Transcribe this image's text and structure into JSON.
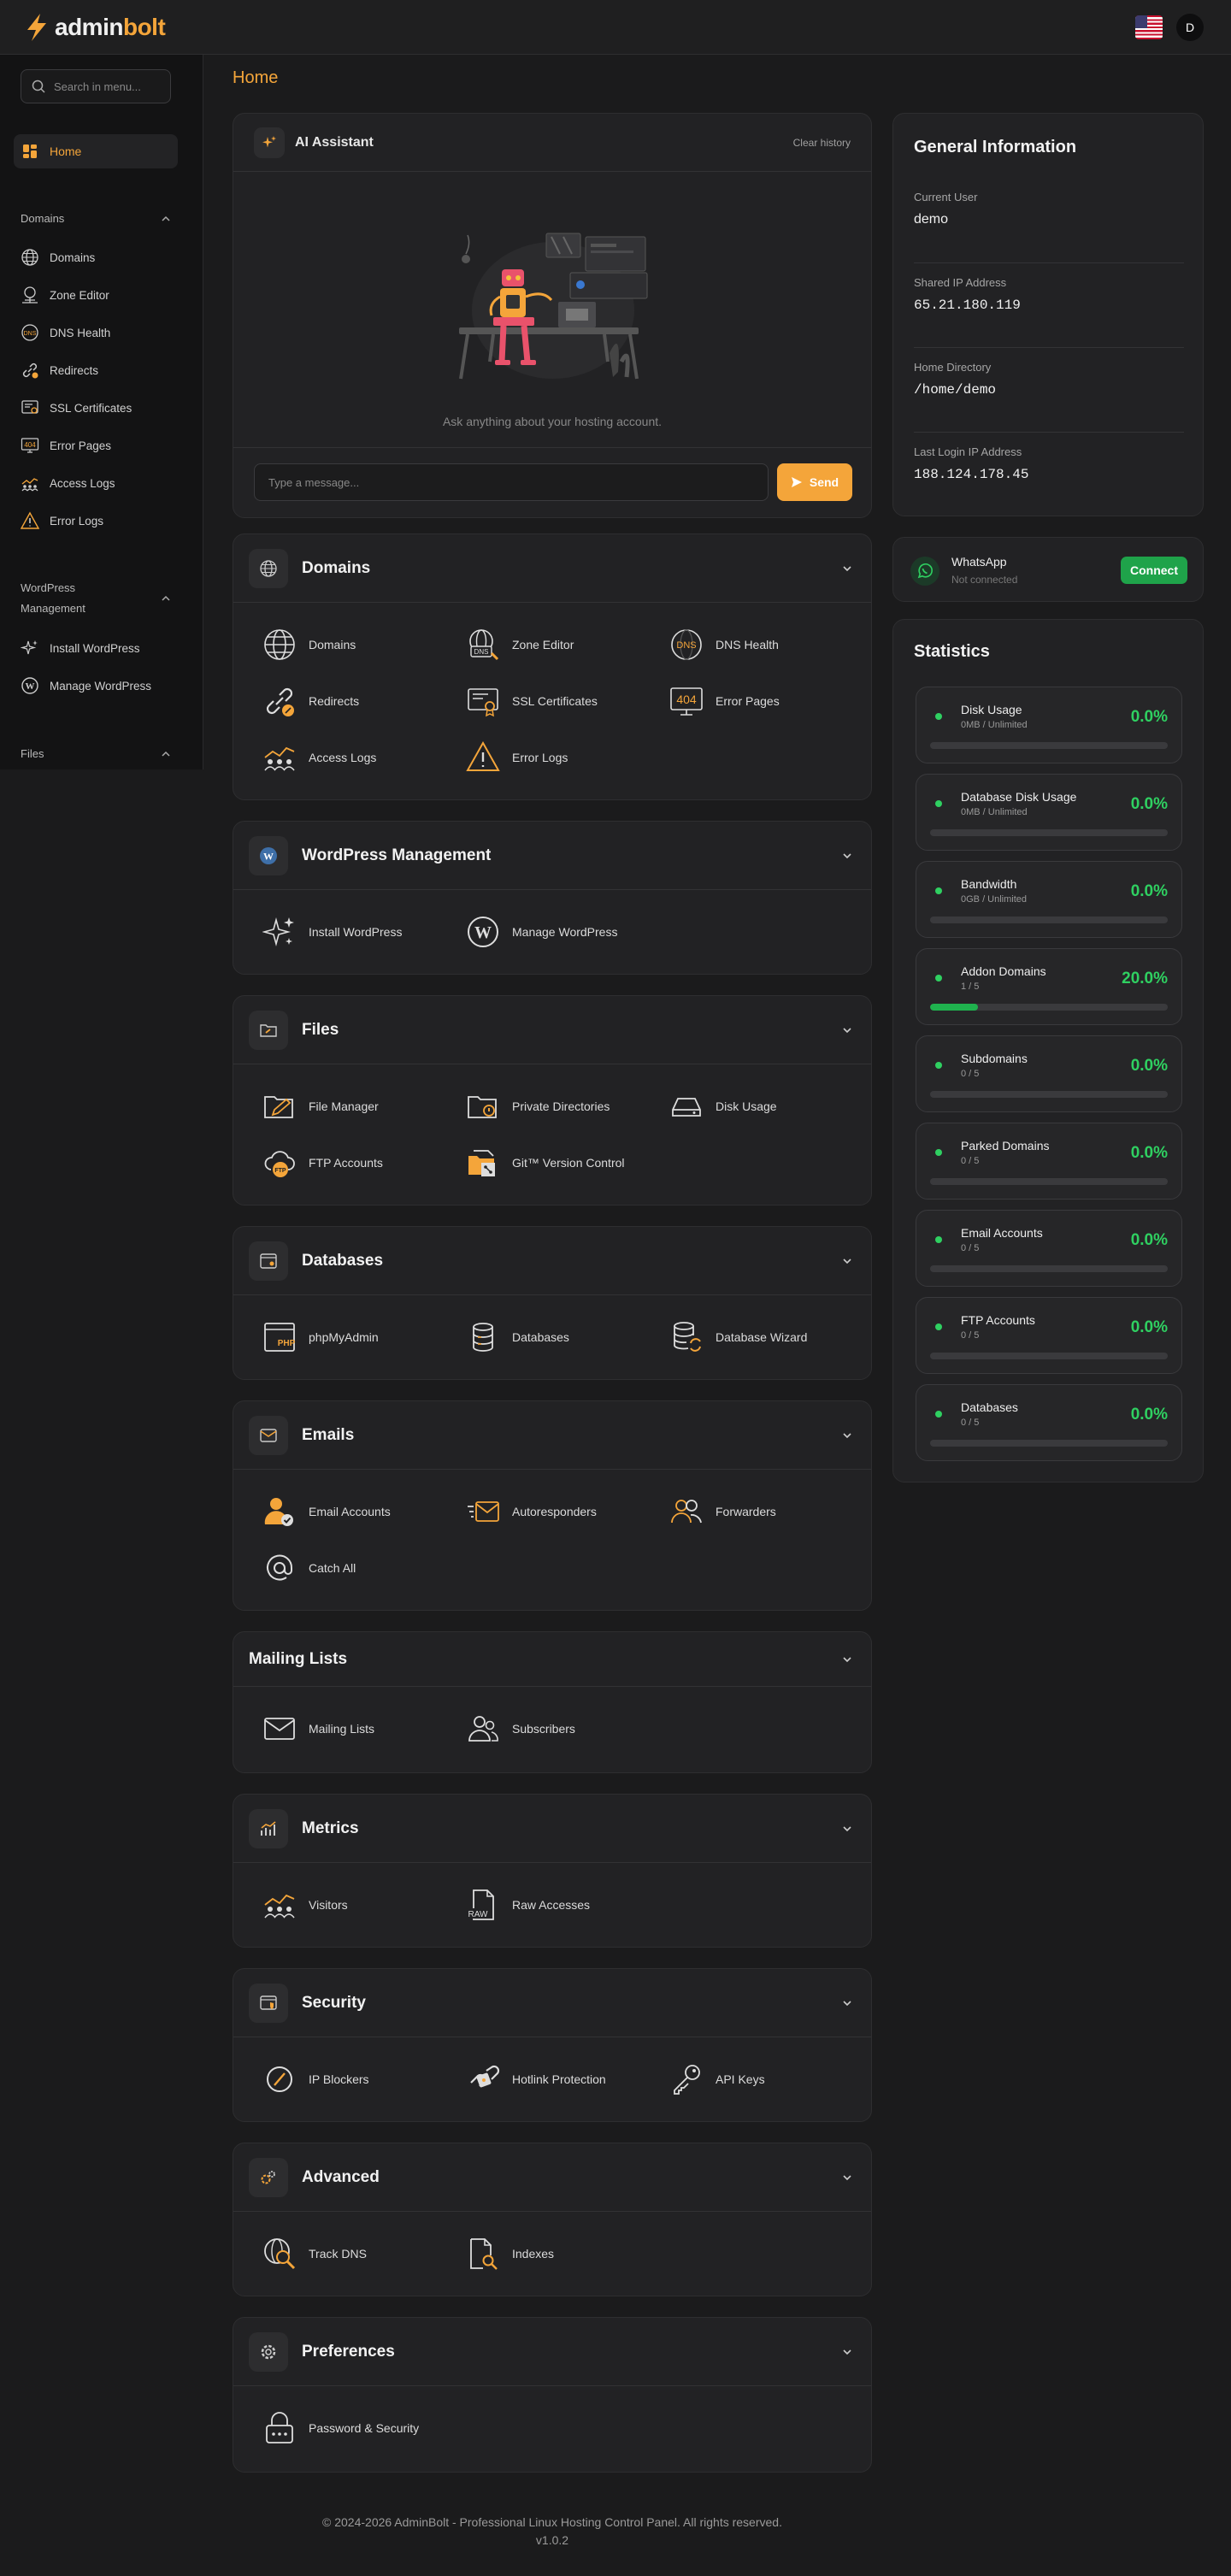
{
  "brand": {
    "name_prefix": "admin",
    "name_suffix": "bolt"
  },
  "topbar": {
    "avatar_letter": "D"
  },
  "sidebar": {
    "search_placeholder": "Search in menu...",
    "home_label": "Home",
    "sections": [
      {
        "title": "Domains"
      },
      {
        "title_line1": "WordPress",
        "title_line2": "Management"
      },
      {
        "title": "Files"
      }
    ],
    "domains_items": [
      "Domains",
      "Zone Editor",
      "DNS Health",
      "Redirects",
      "SSL Certificates",
      "Error Pages",
      "Access Logs",
      "Error Logs"
    ],
    "wordpress_items": [
      "Install WordPress",
      "Manage WordPress"
    ]
  },
  "main": {
    "page_title": "Home"
  },
  "ai": {
    "title": "AI Assistant",
    "clear": "Clear history",
    "hint": "Ask anything about your hosting account.",
    "input_placeholder": "Type a message...",
    "send": "Send"
  },
  "cards": [
    {
      "title": "Domains",
      "items": [
        "Domains",
        "Zone Editor",
        "DNS Health",
        "Redirects",
        "SSL Certificates",
        "Error Pages",
        "Access Logs",
        "Error Logs"
      ]
    },
    {
      "title": "WordPress Management",
      "items": [
        "Install WordPress",
        "Manage WordPress"
      ]
    },
    {
      "title": "Files",
      "items": [
        "File Manager",
        "Private Directories",
        "Disk Usage",
        "FTP Accounts",
        "Git™ Version Control"
      ]
    },
    {
      "title": "Databases",
      "items": [
        "phpMyAdmin",
        "Databases",
        "Database Wizard"
      ]
    },
    {
      "title": "Emails",
      "items": [
        "Email Accounts",
        "Autoresponders",
        "Forwarders",
        "Catch All"
      ]
    },
    {
      "title": "Mailing Lists",
      "items": [
        "Mailing Lists",
        "Subscribers"
      ]
    },
    {
      "title": "Metrics",
      "items": [
        "Visitors",
        "Raw Accesses"
      ]
    },
    {
      "title": "Security",
      "items": [
        "IP Blockers",
        "Hotlink Protection",
        "API Keys"
      ]
    },
    {
      "title": "Advanced",
      "items": [
        "Track DNS",
        "Indexes"
      ]
    },
    {
      "title": "Preferences",
      "items": [
        "Password & Security"
      ]
    }
  ],
  "general_info": {
    "title": "General Information",
    "rows": [
      {
        "label": "Current User",
        "value": "demo"
      },
      {
        "label": "Shared IP Address",
        "value": "65.21.180.119"
      },
      {
        "label": "Home Directory",
        "value": "/home/demo"
      },
      {
        "label": "Last Login IP Address",
        "value": "188.124.178.45"
      }
    ]
  },
  "whatsapp": {
    "name": "WhatsApp",
    "status": "Not connected",
    "button": "Connect"
  },
  "statistics": {
    "title": "Statistics",
    "items": [
      {
        "name": "Disk Usage",
        "sub": "0MB / Unlimited",
        "percent": "0.0%",
        "fill": 0
      },
      {
        "name": "Database Disk Usage",
        "sub": "0MB / Unlimited",
        "percent": "0.0%",
        "fill": 0
      },
      {
        "name": "Bandwidth",
        "sub": "0GB / Unlimited",
        "percent": "0.0%",
        "fill": 0
      },
      {
        "name": "Addon Domains",
        "sub": "1 / 5",
        "percent": "20.0%",
        "fill": 0.2
      },
      {
        "name": "Subdomains",
        "sub": "0 / 5",
        "percent": "0.0%",
        "fill": 0
      },
      {
        "name": "Parked Domains",
        "sub": "0 / 5",
        "percent": "0.0%",
        "fill": 0
      },
      {
        "name": "Email Accounts",
        "sub": "0 / 5",
        "percent": "0.0%",
        "fill": 0
      },
      {
        "name": "FTP Accounts",
        "sub": "0 / 5",
        "percent": "0.0%",
        "fill": 0
      },
      {
        "name": "Databases",
        "sub": "0 / 5",
        "percent": "0.0%",
        "fill": 0
      }
    ]
  },
  "footer": {
    "copyright": "© 2024-2026 AdminBolt - Professional Linux Hosting Control Panel. All rights reserved.",
    "version": "v1.0.2"
  },
  "colors": {
    "accent": "#f4a53a",
    "success": "#2fd061",
    "background": "#1b1b1c"
  }
}
